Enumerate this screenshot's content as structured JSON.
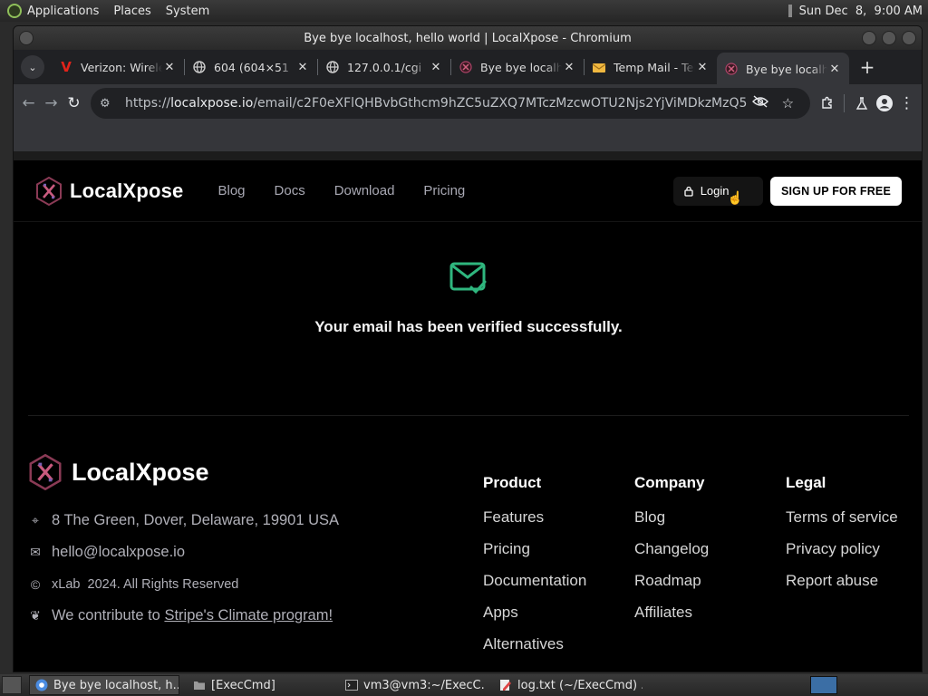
{
  "os_panel": {
    "menus": [
      "Applications",
      "Places",
      "System"
    ],
    "clock": "Sun Dec  8,  9:00 AM"
  },
  "window": {
    "title": "Bye bye localhost, hello world | LocalXpose - Chromium"
  },
  "tabs": [
    {
      "title": "Verizon: Wireless",
      "icon": "verizon-icon"
    },
    {
      "title": "604 (604×51",
      "icon": "globe-icon"
    },
    {
      "title": "127.0.0.1/cgi",
      "icon": "globe-icon"
    },
    {
      "title": "Bye bye localhost",
      "icon": "localxpose-icon"
    },
    {
      "title": "Temp Mail - Temp",
      "icon": "tempmail-icon"
    },
    {
      "title": "Bye bye localhost",
      "icon": "localxpose-icon",
      "active": true
    }
  ],
  "toolbar": {
    "url_prefix": "https://",
    "url_host": "localxpose.io",
    "url_path": "/email/c2F0eXFlQHBvbGthcm9hZC5uZXQ7MTczMzcwOTU2Njs2YjViMDkzMzQ5"
  },
  "site": {
    "brand": "LocalXpose",
    "nav": [
      "Blog",
      "Docs",
      "Download",
      "Pricing"
    ],
    "login": "Login",
    "signup": "SIGN UP FOR FREE",
    "verify_message": "Your email has been verified successfully.",
    "accent": "#2fb67e"
  },
  "footer": {
    "brand": "LocalXpose",
    "address": "8 The Green, Dover, Delaware, 19901 USA",
    "email": "hello@localxpose.io",
    "copyright": "xLab  2024. All Rights Reserved",
    "climate_prefix": "We contribute to ",
    "climate_link": "Stripe's Climate program!",
    "columns": {
      "product": {
        "heading": "Product",
        "links": [
          "Features",
          "Pricing",
          "Documentation",
          "Apps",
          "Alternatives"
        ]
      },
      "company": {
        "heading": "Company",
        "links": [
          "Blog",
          "Changelog",
          "Roadmap",
          "Affiliates"
        ]
      },
      "legal": {
        "heading": "Legal",
        "links": [
          "Terms of service",
          "Privacy policy",
          "Report abuse"
        ]
      }
    }
  },
  "taskbar": {
    "items": [
      {
        "label": "Bye bye localhost, h...",
        "icon": "chromium-icon",
        "active": true
      },
      {
        "label": "[ExecCmd]",
        "icon": "folder-icon"
      },
      {
        "label": "vm3@vm3:~/ExecC...",
        "icon": "terminal-icon"
      },
      {
        "label": "log.txt (~/ExecCmd) ...",
        "icon": "text-editor-icon"
      }
    ]
  }
}
